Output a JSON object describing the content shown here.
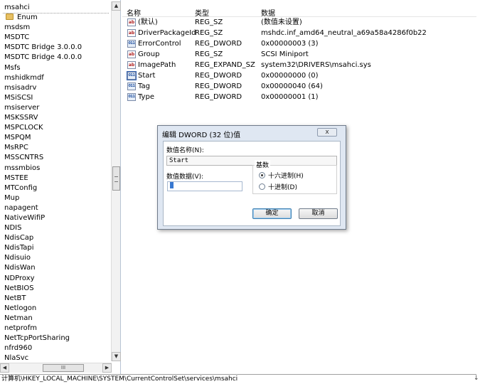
{
  "tree": {
    "items": [
      {
        "label": "msahci",
        "selected": true
      },
      {
        "label": "Enum",
        "child": true
      },
      {
        "label": "msdsm"
      },
      {
        "label": "MSDTC"
      },
      {
        "label": "MSDTC Bridge 3.0.0.0"
      },
      {
        "label": "MSDTC Bridge 4.0.0.0"
      },
      {
        "label": "Msfs"
      },
      {
        "label": "mshidkmdf"
      },
      {
        "label": "msisadrv"
      },
      {
        "label": "MSiSCSI"
      },
      {
        "label": "msiserver"
      },
      {
        "label": "MSKSSRV"
      },
      {
        "label": "MSPCLOCK"
      },
      {
        "label": "MSPQM"
      },
      {
        "label": "MsRPC"
      },
      {
        "label": "MSSCNTRS"
      },
      {
        "label": "mssmbios"
      },
      {
        "label": "MSTEE"
      },
      {
        "label": "MTConfig"
      },
      {
        "label": "Mup"
      },
      {
        "label": "napagent"
      },
      {
        "label": "NativeWifiP"
      },
      {
        "label": "NDIS"
      },
      {
        "label": "NdisCap"
      },
      {
        "label": "NdisTapi"
      },
      {
        "label": "Ndisuio"
      },
      {
        "label": "NdisWan"
      },
      {
        "label": "NDProxy"
      },
      {
        "label": "NetBIOS"
      },
      {
        "label": "NetBT"
      },
      {
        "label": "Netlogon"
      },
      {
        "label": "Netman"
      },
      {
        "label": "netprofm"
      },
      {
        "label": "NetTcpPortSharing"
      },
      {
        "label": "nfrd960"
      },
      {
        "label": "NlaSvc"
      }
    ],
    "hscroll_thumb": "III"
  },
  "values": {
    "headers": {
      "name": "名称",
      "type": "类型",
      "data": "数据"
    },
    "rows": [
      {
        "icon": "ab",
        "name": "(默认)",
        "type": "REG_SZ",
        "data": "(数值未设置)"
      },
      {
        "icon": "ab",
        "name": "DriverPackageId",
        "type": "REG_SZ",
        "data": "mshdc.inf_amd64_neutral_a69a58a4286f0b22"
      },
      {
        "icon": "bin",
        "name": "ErrorControl",
        "type": "REG_DWORD",
        "data": "0x00000003 (3)"
      },
      {
        "icon": "ab",
        "name": "Group",
        "type": "REG_SZ",
        "data": "SCSI Miniport"
      },
      {
        "icon": "ab",
        "name": "ImagePath",
        "type": "REG_EXPAND_SZ",
        "data": "system32\\DRIVERS\\msahci.sys"
      },
      {
        "icon": "bin",
        "name": "Start",
        "type": "REG_DWORD",
        "data": "0x00000000 (0)",
        "selected": true
      },
      {
        "icon": "bin",
        "name": "Tag",
        "type": "REG_DWORD",
        "data": "0x00000040 (64)"
      },
      {
        "icon": "bin",
        "name": "Type",
        "type": "REG_DWORD",
        "data": "0x00000001 (1)"
      }
    ]
  },
  "dialog": {
    "title": "编辑 DWORD (32 位)值",
    "close": "x",
    "name_label": "数值名称(N):",
    "name_value": "Start",
    "data_label": "数值数据(V):",
    "data_value": "0",
    "base_label": "基数",
    "hex_label": "十六进制(H)",
    "dec_label": "十进制(D)",
    "selected_base": "hex",
    "ok_label": "确定",
    "cancel_label": "取消"
  },
  "status": {
    "path": "计算机\\HKEY_LOCAL_MACHINE\\SYSTEM\\CurrentControlSet\\services\\msahci",
    "corner": "↓"
  }
}
